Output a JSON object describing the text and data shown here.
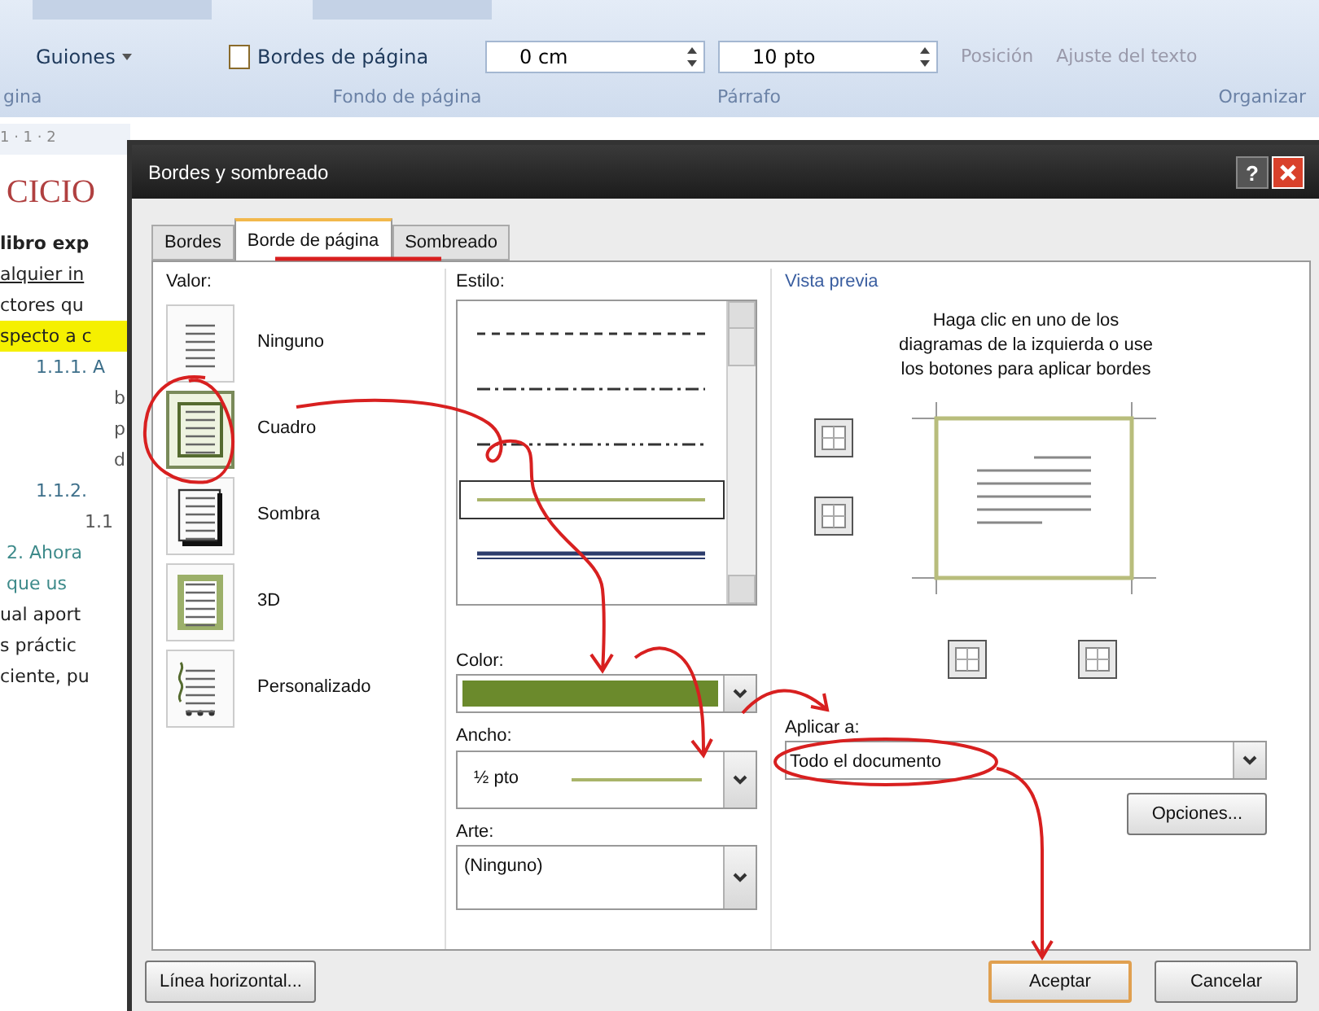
{
  "ribbon": {
    "items": [
      {
        "label": "Guiones",
        "kind": "menu"
      },
      {
        "label": "Bordes de página",
        "kind": "button"
      },
      {
        "label": "0 cm",
        "kind": "spin"
      },
      {
        "label": "10 pto",
        "kind": "spin"
      },
      {
        "label": "Posición",
        "kind": "disabled"
      },
      {
        "label": "Ajuste del texto",
        "kind": "disabled"
      }
    ],
    "groups": [
      "gina",
      "Fondo de página",
      "Párrafo",
      "Organizar"
    ]
  },
  "document": {
    "ruler": "1 · 1 · 2",
    "heading": "CICIO",
    "lines": [
      {
        "text": "libro exp",
        "kind": "bold"
      },
      {
        "text": "alquier in",
        "kind": "link"
      },
      {
        "text": "ctores qu",
        "kind": "plain"
      },
      {
        "text": "specto a c",
        "kind": "highlight"
      },
      {
        "text": "1.1.1. A",
        "kind": "outline"
      },
      {
        "text": "b",
        "kind": "sub"
      },
      {
        "text": "p",
        "kind": "sub"
      },
      {
        "text": "d",
        "kind": "sub"
      },
      {
        "text": "1.1.2.",
        "kind": "outline"
      },
      {
        "text": "1.1",
        "kind": "subnum"
      },
      {
        "text": "2. Ahora",
        "kind": "blue"
      },
      {
        "text": "que us",
        "kind": "blue"
      },
      {
        "text": "ual aport",
        "kind": "plain"
      },
      {
        "text": "s práctic",
        "kind": "plain"
      },
      {
        "text": "ciente, pu",
        "kind": "plain"
      }
    ]
  },
  "dialog": {
    "title": "Bordes y sombreado",
    "help": "?",
    "tabs": [
      {
        "label": "Bordes",
        "selected": false
      },
      {
        "label": "Borde de página",
        "selected": true
      },
      {
        "label": "Sombreado",
        "selected": false
      }
    ],
    "valor": {
      "label": "Valor:",
      "items": [
        {
          "label": "Ninguno",
          "kind": "none",
          "selected": false
        },
        {
          "label": "Cuadro",
          "kind": "box",
          "selected": true
        },
        {
          "label": "Sombra",
          "kind": "shadow",
          "selected": false
        },
        {
          "label": "3D",
          "kind": "threed",
          "selected": false
        },
        {
          "label": "Personalizado",
          "kind": "custom",
          "selected": false
        }
      ]
    },
    "estilo": {
      "label": "Estilo:",
      "styles": [
        {
          "kind": "dashed",
          "selected": false
        },
        {
          "kind": "dashdot",
          "selected": false
        },
        {
          "kind": "dashdotdot",
          "selected": false
        },
        {
          "kind": "solid",
          "selected": true
        },
        {
          "kind": "thick",
          "selected": false
        }
      ]
    },
    "color": {
      "label": "Color:"
    },
    "ancho": {
      "label": "Ancho:",
      "value": "½ pto"
    },
    "arte": {
      "label": "Arte:",
      "value": "(Ninguno)"
    },
    "preview": {
      "label": "Vista previa",
      "hint": "Haga clic en uno de los diagramas de la izquierda o use los botones para aplicar bordes"
    },
    "apply": {
      "label": "Aplicar a:",
      "value": "Todo el documento"
    },
    "buttons": {
      "options": "Opciones...",
      "horizontal": "Línea horizontal...",
      "ok": "Aceptar",
      "cancel": "Cancelar"
    }
  }
}
